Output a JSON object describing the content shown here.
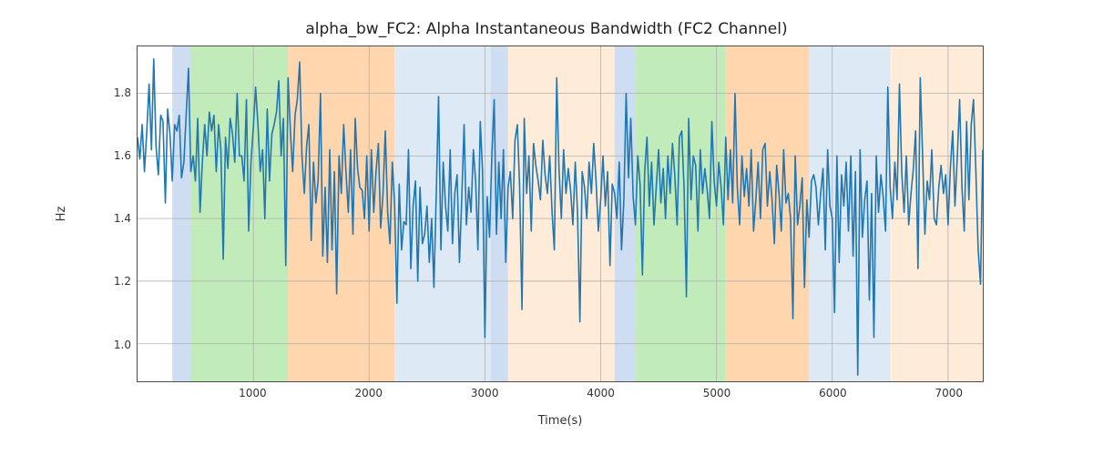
{
  "chart_data": {
    "type": "line",
    "title": "alpha_bw_FC2: Alpha Instantaneous Bandwidth (FC2 Channel)",
    "xlabel": "Time(s)",
    "ylabel": "Hz",
    "xlim": [
      0,
      7300
    ],
    "ylim": [
      0.88,
      1.95
    ],
    "x_ticks": [
      1000,
      2000,
      3000,
      4000,
      5000,
      6000,
      7000
    ],
    "y_ticks": [
      1.0,
      1.2,
      1.4,
      1.6,
      1.8
    ],
    "spans": [
      {
        "x0": 300,
        "x1": 460,
        "color": "#aec7e8",
        "alpha": 0.6
      },
      {
        "x0": 460,
        "x1": 1300,
        "color": "#98df8a",
        "alpha": 0.6
      },
      {
        "x0": 1300,
        "x1": 2220,
        "color": "#ffbb78",
        "alpha": 0.6
      },
      {
        "x0": 2220,
        "x1": 3050,
        "color": "#c6dbef",
        "alpha": 0.6
      },
      {
        "x0": 3050,
        "x1": 3200,
        "color": "#aec7e8",
        "alpha": 0.6
      },
      {
        "x0": 3200,
        "x1": 4120,
        "color": "#ffe4c7",
        "alpha": 0.7
      },
      {
        "x0": 4120,
        "x1": 4300,
        "color": "#aec7e8",
        "alpha": 0.6
      },
      {
        "x0": 4300,
        "x1": 5080,
        "color": "#98df8a",
        "alpha": 0.6
      },
      {
        "x0": 5080,
        "x1": 5800,
        "color": "#ffbb78",
        "alpha": 0.6
      },
      {
        "x0": 5800,
        "x1": 6500,
        "color": "#c6dbef",
        "alpha": 0.6
      },
      {
        "x0": 6500,
        "x1": 7300,
        "color": "#ffe4c7",
        "alpha": 0.7
      }
    ],
    "series": [
      {
        "name": "alpha_bw_FC2",
        "x_start": 0,
        "dx": 20,
        "values": [
          1.66,
          1.59,
          1.7,
          1.55,
          1.68,
          1.83,
          1.62,
          1.91,
          1.63,
          1.54,
          1.73,
          1.71,
          1.45,
          1.75,
          1.67,
          1.52,
          1.7,
          1.68,
          1.73,
          1.53,
          1.58,
          1.73,
          1.88,
          1.55,
          1.6,
          1.52,
          1.72,
          1.42,
          1.58,
          1.7,
          1.6,
          1.74,
          1.68,
          1.73,
          1.55,
          1.7,
          1.62,
          1.27,
          1.66,
          1.56,
          1.72,
          1.67,
          1.58,
          1.8,
          1.6,
          1.6,
          1.52,
          1.78,
          1.36,
          1.58,
          1.69,
          1.82,
          1.7,
          1.55,
          1.62,
          1.4,
          1.75,
          1.52,
          1.67,
          1.7,
          1.74,
          1.84,
          1.6,
          1.72,
          1.25,
          1.85,
          1.68,
          1.55,
          1.73,
          1.78,
          1.9,
          1.6,
          1.48,
          1.63,
          1.7,
          1.33,
          1.58,
          1.45,
          1.52,
          1.8,
          1.28,
          1.5,
          1.26,
          1.62,
          1.3,
          1.55,
          1.16,
          1.6,
          1.48,
          1.7,
          1.55,
          1.42,
          1.62,
          1.35,
          1.72,
          1.56,
          1.5,
          1.49,
          1.4,
          1.6,
          1.36,
          1.62,
          1.42,
          1.55,
          1.64,
          1.37,
          1.48,
          1.68,
          1.42,
          1.32,
          1.58,
          1.45,
          1.13,
          1.51,
          1.3,
          1.39,
          1.38,
          1.62,
          1.24,
          1.44,
          1.52,
          1.2,
          1.5,
          1.32,
          1.35,
          1.44,
          1.26,
          1.4,
          1.18,
          1.48,
          1.79,
          1.3,
          1.58,
          1.44,
          1.36,
          1.62,
          1.32,
          1.48,
          1.54,
          1.26,
          1.46,
          1.7,
          1.38,
          1.5,
          1.42,
          1.62,
          1.52,
          1.3,
          1.71,
          1.55,
          1.02,
          1.47,
          1.34,
          1.6,
          1.78,
          1.35,
          1.58,
          1.4,
          1.62,
          1.26,
          1.5,
          1.55,
          1.4,
          1.65,
          1.7,
          1.5,
          1.11,
          1.72,
          1.48,
          1.6,
          1.36,
          1.64,
          1.57,
          1.52,
          1.46,
          1.65,
          1.54,
          1.48,
          1.6,
          1.42,
          1.3,
          1.85,
          1.56,
          1.4,
          1.62,
          1.48,
          1.56,
          1.49,
          1.38,
          1.58,
          1.42,
          1.07,
          1.55,
          1.5,
          1.4,
          1.58,
          1.48,
          1.64,
          1.52,
          1.36,
          1.46,
          1.6,
          1.44,
          1.55,
          1.25,
          1.51,
          1.48,
          1.4,
          1.58,
          1.3,
          1.46,
          1.8,
          1.53,
          1.72,
          1.47,
          1.38,
          1.6,
          1.51,
          1.22,
          1.55,
          1.66,
          1.44,
          1.58,
          1.38,
          1.5,
          1.62,
          1.45,
          1.56,
          1.4,
          1.6,
          1.48,
          1.64,
          1.54,
          1.38,
          1.66,
          1.68,
          1.5,
          1.15,
          1.72,
          1.46,
          1.6,
          1.57,
          1.36,
          1.62,
          1.48,
          1.56,
          1.49,
          1.4,
          1.71,
          1.52,
          1.44,
          1.58,
          1.5,
          1.38,
          1.66,
          1.46,
          1.62,
          1.45,
          1.8,
          1.5,
          1.38,
          1.6,
          1.47,
          1.56,
          1.44,
          1.62,
          1.36,
          1.46,
          1.58,
          1.4,
          1.62,
          1.64,
          1.44,
          1.55,
          1.46,
          1.32,
          1.57,
          1.48,
          1.36,
          1.62,
          1.45,
          1.48,
          1.4,
          1.08,
          1.6,
          1.38,
          1.44,
          1.53,
          1.18,
          1.46,
          1.34,
          1.52,
          1.54,
          1.5,
          1.38,
          1.48,
          1.56,
          1.3,
          1.62,
          1.44,
          1.4,
          1.1,
          1.6,
          1.26,
          1.54,
          1.44,
          1.58,
          1.36,
          1.6,
          1.28,
          1.55,
          0.9,
          1.62,
          1.34,
          1.46,
          1.52,
          1.14,
          1.48,
          1.02,
          1.6,
          1.42,
          1.54,
          1.47,
          1.36,
          1.82,
          1.5,
          1.4,
          1.58,
          1.46,
          1.83,
          1.55,
          1.42,
          1.6,
          1.38,
          1.48,
          1.56,
          1.68,
          1.24,
          1.85,
          1.6,
          1.35,
          1.52,
          1.46,
          1.62,
          1.4,
          1.38,
          1.5,
          1.57,
          1.48,
          1.54,
          1.38,
          1.56,
          1.68,
          1.44,
          1.6,
          1.78,
          1.5,
          1.36,
          1.71,
          1.46,
          1.7,
          1.78,
          1.55,
          1.3,
          1.19,
          1.62
        ]
      }
    ]
  }
}
